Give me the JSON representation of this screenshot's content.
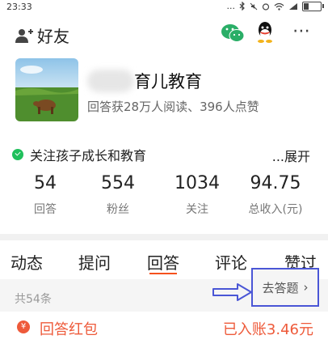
{
  "status": {
    "time": "23:33",
    "dots": "..."
  },
  "header": {
    "friends_label": "好友",
    "more_label": "⋯"
  },
  "profile": {
    "name_suffix": "育儿教育",
    "stats": "回答获28万人阅读、396人点赞",
    "topic": "关注孩子成长和教育",
    "expand": "...展开"
  },
  "metrics": [
    {
      "value": "54",
      "label": "回答"
    },
    {
      "value": "554",
      "label": "粉丝"
    },
    {
      "value": "1034",
      "label": "关注"
    },
    {
      "value": "94.75",
      "label": "总收入(元)"
    }
  ],
  "tabs": [
    {
      "label": "动态"
    },
    {
      "label": "提问"
    },
    {
      "label": "回答"
    },
    {
      "label": "评论"
    },
    {
      "label": "赞过"
    }
  ],
  "list": {
    "count": "共54条",
    "go_answer": "去答题",
    "chevron": "›"
  },
  "redpack": {
    "icon": "¥",
    "label": "回答红包",
    "amount": "已入账3.46元"
  },
  "colors": {
    "accent": "#ee5a3a",
    "tab_underline": "#f5511d",
    "annotation": "#4a56d6",
    "check_green": "#20c05c"
  }
}
